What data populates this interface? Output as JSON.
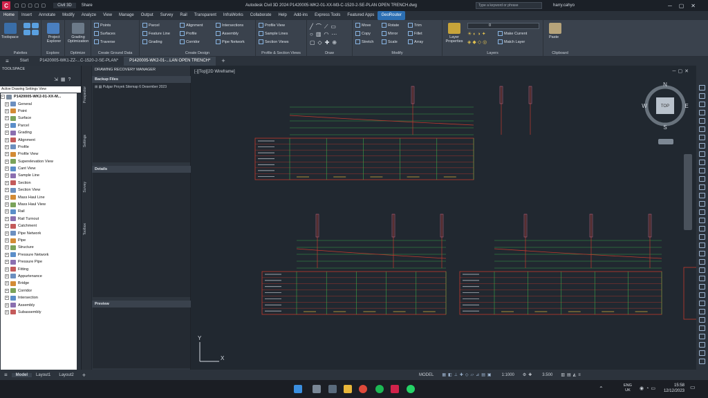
{
  "titlebar": {
    "app_logo": "C",
    "workspace": "Civil 3D",
    "share": "Share",
    "title": "Autodesk Civil 3D 2024    P1420005-WK2-01-XX-M3-C-1520-2-SE-PLAN OPEN TRENCH.dwg",
    "search_placeholder": "Type a keyword or phrase",
    "user": "harry.cahyo"
  },
  "menu": [
    "Home",
    "Insert",
    "Annotate",
    "Modify",
    "Analyze",
    "View",
    "Manage",
    "Output",
    "Survey",
    "Rail",
    "Transparent",
    "InfraWorks",
    "Collaborate",
    "Help",
    "Add-ins",
    "Express Tools",
    "Featured Apps",
    "GeoRouter"
  ],
  "ribbon": {
    "toolspace": "Toolspace",
    "project_explorer": "Project Explorer",
    "grading_optimization": "Grading Optimization",
    "points": "Points",
    "surfaces": "Surfaces",
    "traverse": "Traverse",
    "parcel": "Parcel",
    "feature_line": "Feature Line",
    "grading": "Grading",
    "alignment": "Alignment",
    "profile": "Profile",
    "corridor": "Corridor",
    "intersections": "Intersections",
    "assembly": "Assembly",
    "pipe_network": "Pipe Network",
    "profile_view": "Profile View",
    "sample_lines": "Sample Lines",
    "section_views": "Section Views",
    "move": "Move",
    "copy": "Copy",
    "stretch": "Stretch",
    "rotate": "Rotate",
    "mirror": "Mirror",
    "scale": "Scale",
    "trim": "Trim",
    "fillet": "Fillet",
    "array": "Array",
    "layer_properties": "Layer Properties",
    "make_current": "Make Current",
    "match_layer": "Match Layer",
    "paste": "Paste",
    "layer_value": "0",
    "panels": {
      "palettes": "Palettes",
      "explore": "Explore",
      "optimize": "Optimize",
      "create_ground_data": "Create Ground Data",
      "create_design": "Create Design",
      "profile_section": "Profile & Section Views",
      "draw": "Draw",
      "modify": "Modify",
      "layers": "Layers",
      "clipboard": "Clipboard"
    }
  },
  "doctabs": [
    "Start",
    "P1420005-WK1-ZZ-...C-1520-2-SE-PLAN*",
    "P1420005-WK2-01-...LAN OPEN TRENCH*"
  ],
  "toolspace": {
    "title": "TOOLSPACE",
    "view": "Active Drawing Settings View",
    "root": "P1420005-WK2-01-XX-M...",
    "items": [
      "General",
      "Point",
      "Surface",
      "Parcel",
      "Grading",
      "Alignment",
      "Profile",
      "Profile View",
      "Superelevation View",
      "Cant View",
      "Sample Line",
      "Section",
      "Section View",
      "Mass Haul Line",
      "Mass Haul View",
      "Rail",
      "Rail Turnout",
      "Catchment",
      "Pipe Network",
      "Pipe",
      "Structure",
      "Pressure Network",
      "Pressure Pipe",
      "Fitting",
      "Appurtenance",
      "Bridge",
      "Corridor",
      "Intersection",
      "Assembly",
      "Subassembly"
    ]
  },
  "vtabs": [
    "Prospector",
    "Settings",
    "Survey",
    "Toolbox"
  ],
  "drm": {
    "title": "DRAWING RECOVERY MANAGER",
    "backup_files": "Backup Files",
    "backup_item": "Pulgar Proyek Sitemap 6 Desember 2023",
    "details": "Details",
    "preview": "Preview"
  },
  "viewport": {
    "label": "[-][Top][2D Wireframe]",
    "viewcube_top": "TOP",
    "compass": {
      "n": "N",
      "s": "S",
      "e": "E",
      "w": "W"
    }
  },
  "status": {
    "model_tab": "Model",
    "layout1": "Layout1",
    "layout2": "Layout2",
    "model": "MODEL",
    "scale": "1:1000",
    "value": "3.500"
  },
  "taskbar": {
    "lang": "ENG",
    "region": "UK",
    "time": "15:58",
    "date": "12/12/2023"
  },
  "colors": {
    "accent": "#2c6fb3",
    "drawing_red": "#c23a2e",
    "drawing_green": "#3fbf4f",
    "drawing_grey": "#8c9aa6"
  }
}
